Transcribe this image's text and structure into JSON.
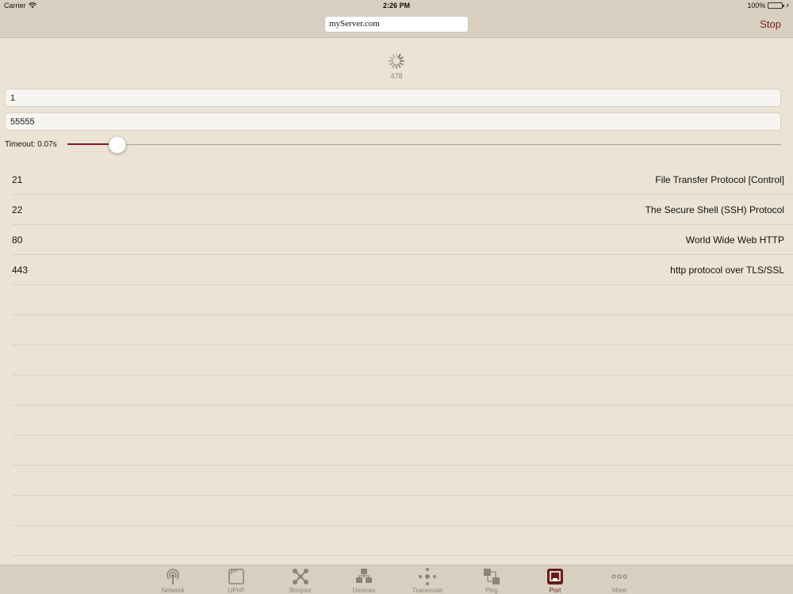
{
  "status_bar": {
    "carrier": "Carrier",
    "time": "2:26 PM",
    "battery": "100%",
    "battery_level": 1.0
  },
  "nav": {
    "url": "myServer.com",
    "stop_label": "Stop"
  },
  "scan": {
    "count": "478"
  },
  "inputs": {
    "start_port": "1",
    "end_port": "55555"
  },
  "timeout": {
    "label": "Timeout: 0.07s",
    "slider_fraction": 0.07
  },
  "results": [
    {
      "port": "21",
      "description": "File Transfer Protocol [Control]"
    },
    {
      "port": "22",
      "description": "The Secure Shell (SSH) Protocol"
    },
    {
      "port": "80",
      "description": "World Wide Web HTTP"
    },
    {
      "port": "443",
      "description": "http protocol over TLS/SSL"
    }
  ],
  "tabs": [
    {
      "label": "Network",
      "icon": "network-icon"
    },
    {
      "label": "UPnP",
      "icon": "upnp-icon"
    },
    {
      "label": "Bonjour",
      "icon": "bonjour-icon"
    },
    {
      "label": "Devices",
      "icon": "devices-icon"
    },
    {
      "label": "Traceroute",
      "icon": "traceroute-icon"
    },
    {
      "label": "Ping",
      "icon": "ping-icon"
    },
    {
      "label": "Port",
      "icon": "port-icon",
      "active": true
    },
    {
      "label": "More",
      "icon": "more-icon"
    }
  ],
  "colors": {
    "accent": "#7a1e1e",
    "background": "#ebe3d5",
    "bar": "#d8cfc0",
    "inactive": "#8a8479"
  }
}
